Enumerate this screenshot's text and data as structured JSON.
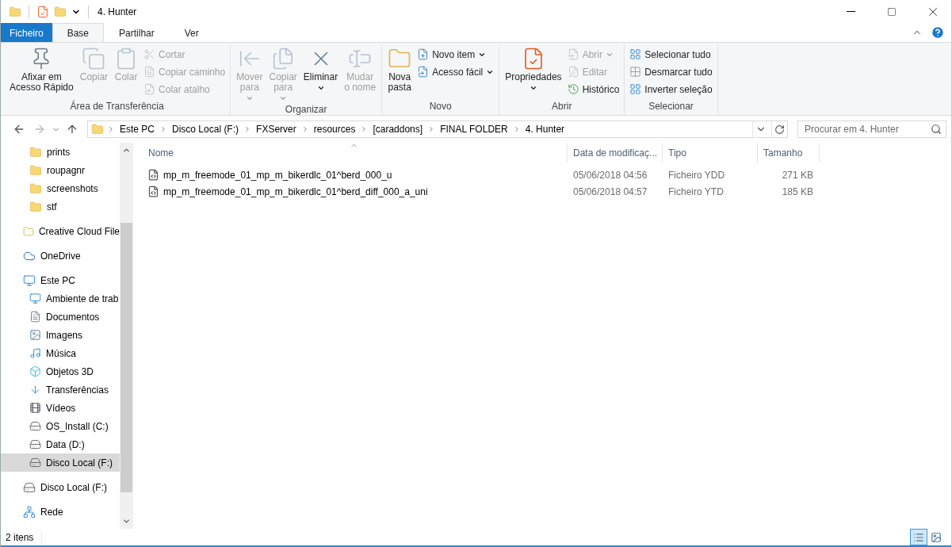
{
  "window": {
    "title": "4. Hunter"
  },
  "tabs": [
    {
      "label": "Ficheiro",
      "kind": "file",
      "selected": false
    },
    {
      "label": "Base",
      "kind": "tab",
      "selected": true
    },
    {
      "label": "Partilhar",
      "kind": "tab",
      "selected": false
    },
    {
      "label": "Ver",
      "kind": "tab",
      "selected": false
    }
  ],
  "ribbon": {
    "groups": [
      {
        "label": "Área de Transferência",
        "buttons": [
          {
            "kind": "large",
            "label": "Afixar em\nAcesso Rápido",
            "disabled": false,
            "dropdown": false
          },
          {
            "kind": "large",
            "label": "Copiar",
            "disabled": true,
            "dropdown": false
          },
          {
            "kind": "large",
            "label": "Colar",
            "disabled": true,
            "dropdown": false
          },
          {
            "kind": "small",
            "label": "Cortar",
            "disabled": true,
            "dropdown": false
          },
          {
            "kind": "small",
            "label": "Copiar caminho",
            "disabled": true,
            "dropdown": false
          },
          {
            "kind": "small",
            "label": "Colar atalho",
            "disabled": true,
            "dropdown": false
          }
        ]
      },
      {
        "label": "Organizar",
        "buttons": [
          {
            "kind": "large",
            "label": "Mover\npara",
            "disabled": true,
            "dropdown": true
          },
          {
            "kind": "large",
            "label": "Copiar\npara",
            "disabled": true,
            "dropdown": true
          },
          {
            "kind": "large",
            "label": "Eliminar",
            "disabled": false,
            "dropdown": true
          },
          {
            "kind": "large",
            "label": "Mudar\no nome",
            "disabled": true,
            "dropdown": false
          }
        ]
      },
      {
        "label": "Novo",
        "buttons": [
          {
            "kind": "large",
            "label": "Nova\npasta",
            "disabled": false,
            "dropdown": false
          },
          {
            "kind": "small",
            "label": "Novo item",
            "disabled": false,
            "dropdown": true
          },
          {
            "kind": "small",
            "label": "Acesso fácil",
            "disabled": false,
            "dropdown": true
          }
        ]
      },
      {
        "label": "Abrir",
        "buttons": [
          {
            "kind": "large",
            "label": "Propriedades",
            "disabled": false,
            "dropdown": true
          },
          {
            "kind": "small",
            "label": "Abrir",
            "disabled": true,
            "dropdown": true
          },
          {
            "kind": "small",
            "label": "Editar",
            "disabled": true,
            "dropdown": false
          },
          {
            "kind": "small",
            "label": "Histórico",
            "disabled": false,
            "dropdown": false
          }
        ]
      },
      {
        "label": "Selecionar",
        "buttons": [
          {
            "kind": "small",
            "label": "Selecionar tudo",
            "disabled": false,
            "dropdown": false
          },
          {
            "kind": "small",
            "label": "Desmarcar tudo",
            "disabled": false,
            "dropdown": false
          },
          {
            "kind": "small",
            "label": "Inverter seleção",
            "disabled": false,
            "dropdown": false
          }
        ]
      }
    ]
  },
  "address_bar": {
    "crumbs": [
      "Este PC",
      "Disco Local (F:)",
      "FXServer",
      "resources",
      "[caraddons]",
      "FINAL FOLDER",
      "4. Hunter"
    ]
  },
  "search": {
    "placeholder": "Procurar em 4. Hunter"
  },
  "sidebar": {
    "continued_items": [
      {
        "label": "prints",
        "selected": false
      },
      {
        "label": "roupagnr",
        "selected": false
      },
      {
        "label": "screenshots",
        "selected": false
      },
      {
        "label": "stf",
        "selected": false
      }
    ],
    "items": [
      {
        "label": "Creative Cloud File",
        "selected": false
      },
      {
        "label": "OneDrive",
        "selected": false
      },
      {
        "label": "Este PC",
        "selected": false,
        "children": [
          {
            "label": "Ambiente de trab",
            "selected": false
          },
          {
            "label": "Documentos",
            "selected": false
          },
          {
            "label": "Imagens",
            "selected": false
          },
          {
            "label": "Música",
            "selected": false
          },
          {
            "label": "Objetos 3D",
            "selected": false
          },
          {
            "label": "Transferências",
            "selected": false
          },
          {
            "label": "Vídeos",
            "selected": false
          },
          {
            "label": "OS_Install (C:)",
            "selected": false
          },
          {
            "label": "Data (D:)",
            "selected": false
          },
          {
            "label": "Disco Local (F:)",
            "selected": true
          }
        ]
      },
      {
        "label": "Disco Local (F:)",
        "selected": false
      },
      {
        "label": "Rede",
        "selected": false
      }
    ]
  },
  "table": {
    "columns": [
      "Nome",
      "Data de modificaç...",
      "Tipo",
      "Tamanho"
    ],
    "rows": [
      {
        "name": "mp_m_freemode_01_mp_m_bikerdlc_01^berd_000_u",
        "date": "05/06/2018 04:56",
        "type": "Ficheiro YDD",
        "size": "271 KB"
      },
      {
        "name": "mp_m_freemode_01_mp_m_bikerdlc_01^berd_diff_000_a_uni",
        "date": "05/06/2018 04:57",
        "type": "Ficheiro YTD",
        "size": "185 KB"
      }
    ]
  },
  "status_bar": {
    "count": "2 itens",
    "views": [
      {
        "kind": "details",
        "selected": true
      },
      {
        "kind": "large_icons",
        "selected": false
      }
    ]
  }
}
